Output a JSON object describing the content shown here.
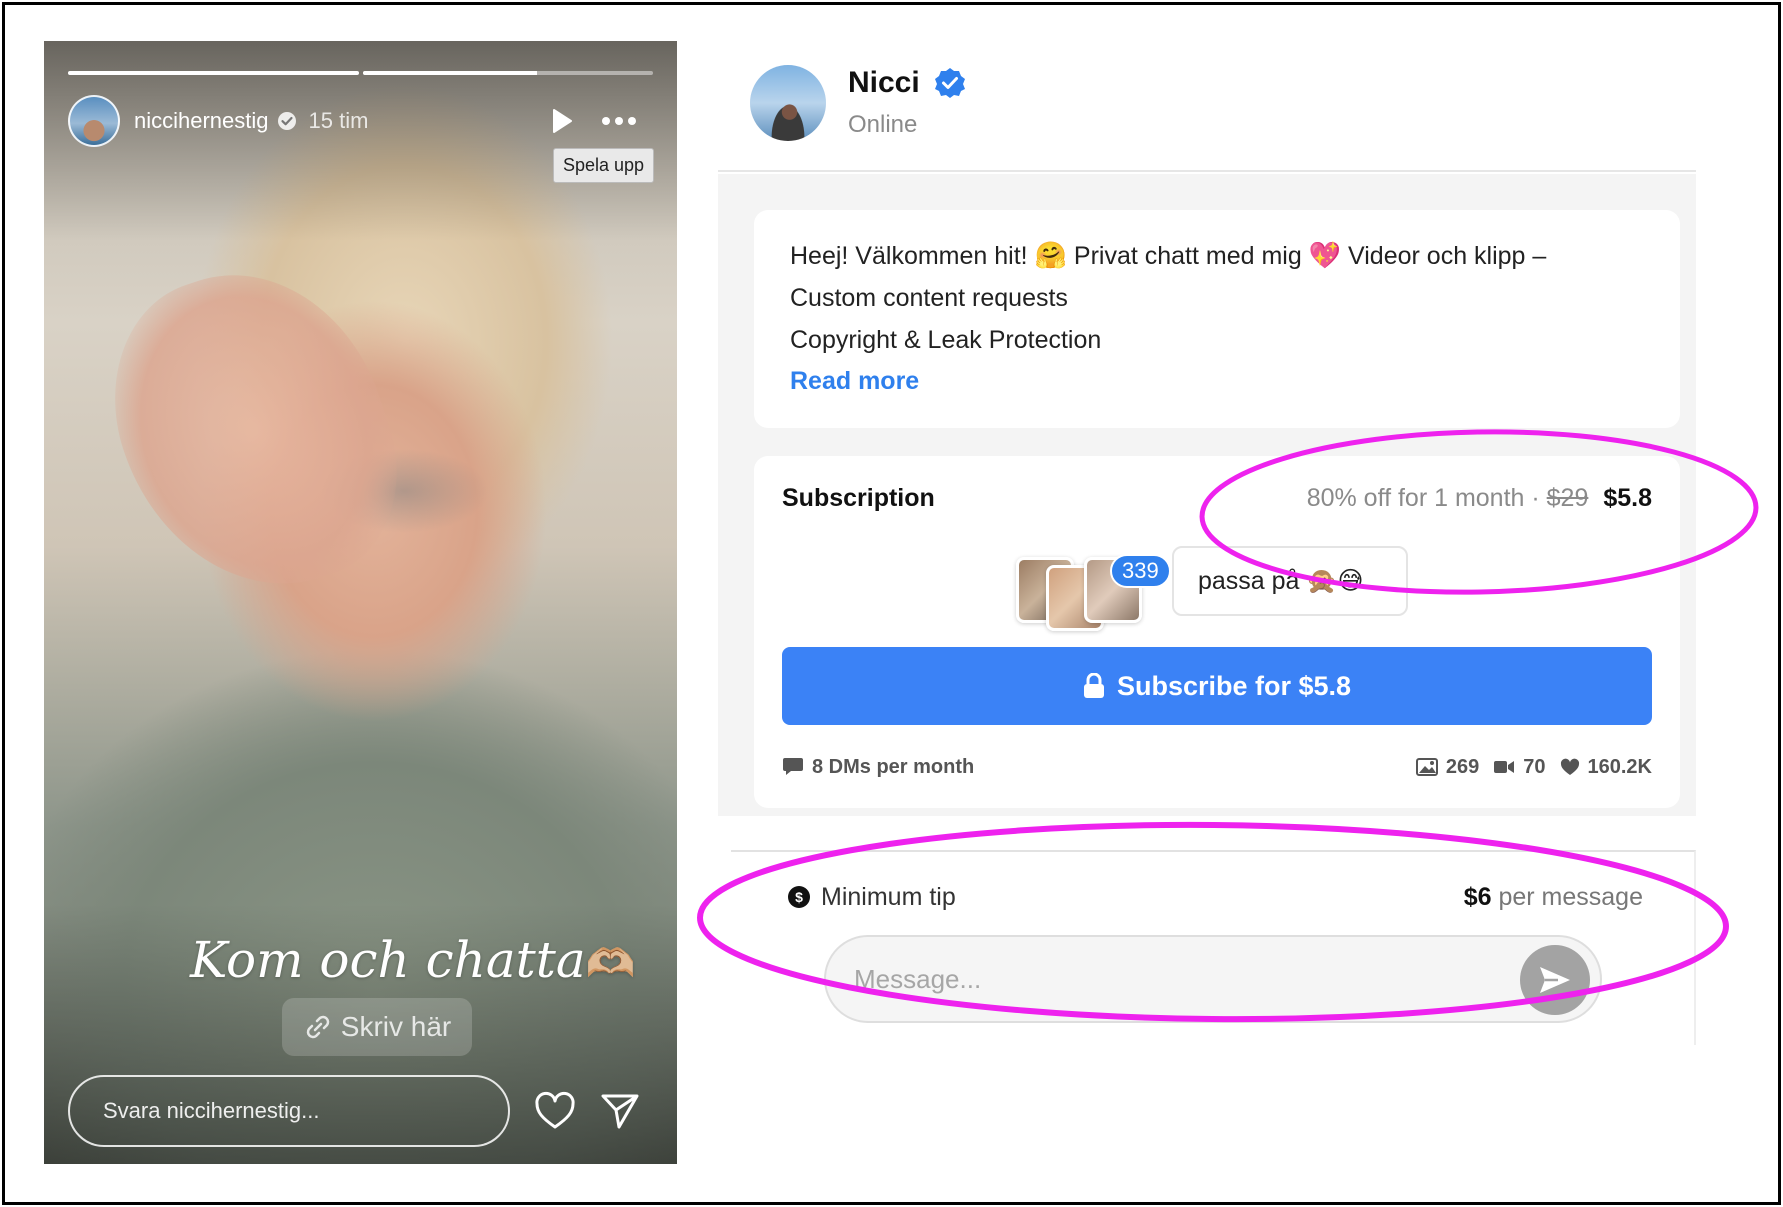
{
  "story": {
    "progress": [
      1.0,
      0.6
    ],
    "username": "niccihernestig",
    "time": "15 tim",
    "tooltip": "Spela upp",
    "caption": "Kom och chatta",
    "caption_emoji": "🫶🏼",
    "link_sticker": "Skriv här",
    "reply_placeholder": "Svara niccihernestig...",
    "icons": [
      "verified-icon",
      "play-icon",
      "more-icon",
      "link-icon",
      "heart-icon",
      "send-icon"
    ]
  },
  "profile": {
    "name": "Nicci",
    "status": "Online",
    "bio": {
      "line1_a": "Heej! Välkommen hit!",
      "line1_emoji1": "🤗",
      "line1_b": "Privat chatt med mig",
      "line1_emoji2": "💖",
      "line1_c": "Videor och klipp –",
      "line2": "Custom content requests",
      "line3": "Copyright & Leak Protection",
      "read_more": "Read more"
    },
    "subscription": {
      "title": "Subscription",
      "offer_text": "80% off for 1 month ·",
      "old_price": "$29",
      "new_price": "$5.8",
      "subscriber_count": "339",
      "comment": "passa på 🙊😅",
      "button_label": "Subscribe for $5.8",
      "dms": "8 DMs per month",
      "photos": "269",
      "videos": "70",
      "likes": "160.2K"
    },
    "tip": {
      "label": "Minimum tip",
      "amount": "$6",
      "unit": "per message"
    },
    "message_placeholder": "Message..."
  },
  "colors": {
    "accent_blue": "#3b82f6",
    "link_blue": "#2f80ed",
    "annotation_magenta": "#ee22ee"
  }
}
